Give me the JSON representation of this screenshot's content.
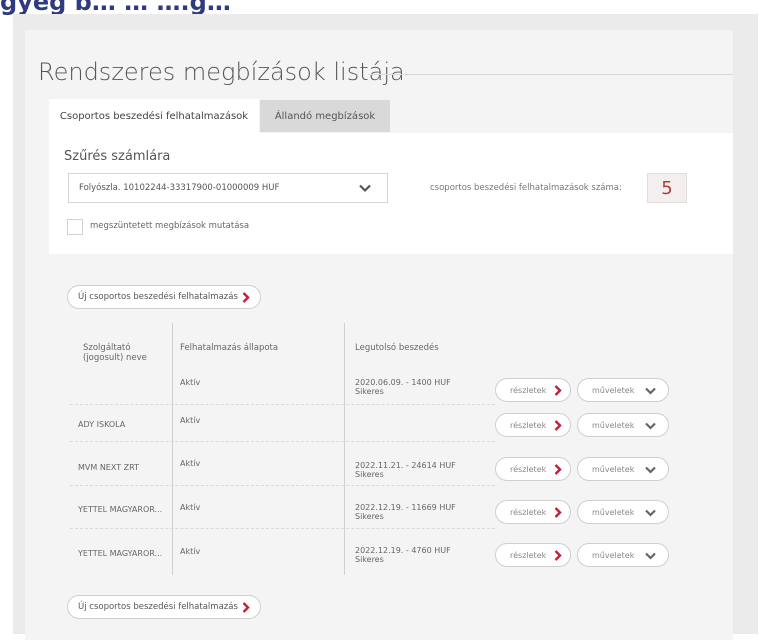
{
  "top_heading": "gyeg b… … ….g…",
  "page_title": "Rendszeres megbízások listája",
  "tabs": [
    {
      "label": "Csoportos beszedési felhatalmazások"
    },
    {
      "label": "Állandó megbízások"
    }
  ],
  "filter": {
    "title": "Szűrés számlára",
    "account_value": "Folyószla. 10102244-33317900-01000009 HUF",
    "count_label": "csoportos beszedési felhatalmazások száma:",
    "count_value": "5",
    "checkbox_label": "megszüntetett megbízások mutatása"
  },
  "new_button_label": "Új csoportos beszedési felhatalmazás",
  "table": {
    "headers": [
      "Szolgáltató (jogosult) neve",
      "Felhatalmazás állapota",
      "Legutolsó beszedés"
    ],
    "rows": [
      {
        "provider": "",
        "status": "Aktív",
        "last": "2020.06.09. - 1400 HUF",
        "result": "Sikeres"
      },
      {
        "provider": "ADY ISKOLA",
        "status": "Aktív",
        "last": "",
        "result": ""
      },
      {
        "provider": "MVM NEXT ZRT",
        "status": "Aktív",
        "last": "2022.11.21. - 24614 HUF",
        "result": "Sikeres"
      },
      {
        "provider": "YETTEL MAGYAROR...",
        "status": "Aktív",
        "last": "2022.12.19. - 11669 HUF",
        "result": "Sikeres"
      },
      {
        "provider": "YETTEL MAGYAROR...",
        "status": "Aktív",
        "last": "2022.12.19. - 4760 HUF",
        "result": "Sikeres"
      }
    ],
    "details_label": "részletek",
    "actions_label": "műveletek"
  },
  "colors": {
    "accent_red": "#c0203a",
    "count_text": "#b33a3a",
    "heading_blue": "#2f3a7f"
  }
}
